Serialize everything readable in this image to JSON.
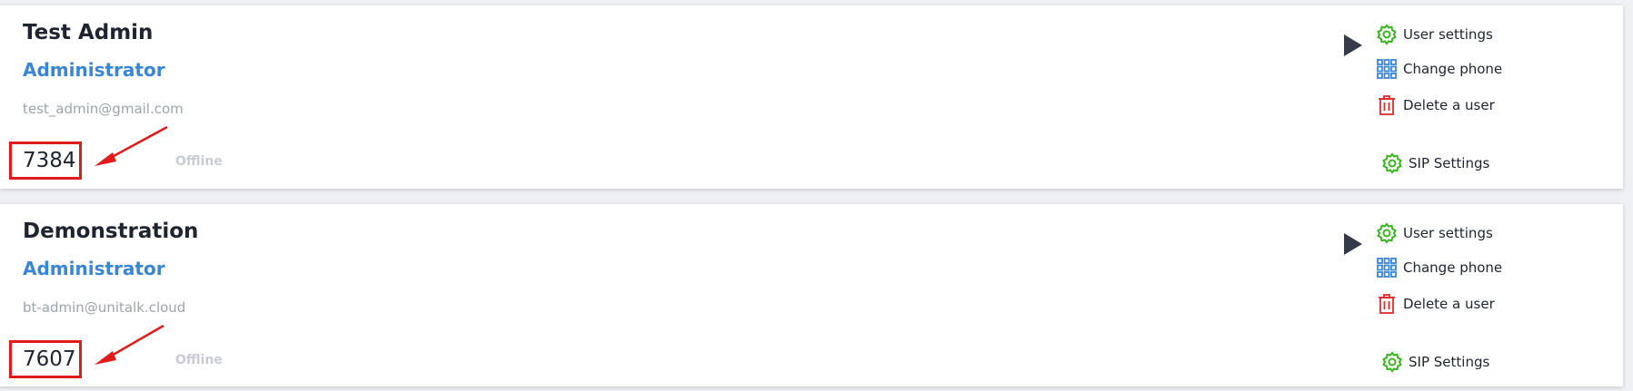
{
  "users": [
    {
      "name": "Test Admin",
      "role": "Administrator",
      "email": "test_admin@gmail.com",
      "extension": "7384",
      "status": "Offline",
      "actions": {
        "user_settings": "User settings",
        "change_phone": "Change phone",
        "delete_user": "Delete a user",
        "sip_settings": "SIP Settings"
      }
    },
    {
      "name": "Demonstration",
      "role": "Administrator",
      "email": "bt-admin@unitalk.cloud",
      "extension": "7607",
      "status": "Offline",
      "actions": {
        "user_settings": "User settings",
        "change_phone": "Change phone",
        "delete_user": "Delete a user",
        "sip_settings": "SIP Settings"
      }
    }
  ],
  "colors": {
    "role": "#3a86d6",
    "settings_icon": "#39b51f",
    "phone_icon": "#3a86d6",
    "delete_icon": "#e02b2b",
    "annotation": "#e01b1b",
    "status": "#c8ccd2"
  },
  "icons": {
    "play": "play-icon",
    "settings": "gear-icon",
    "phone": "keypad-icon",
    "delete": "trash-icon",
    "annotation_arrow": "red-arrow-icon"
  }
}
